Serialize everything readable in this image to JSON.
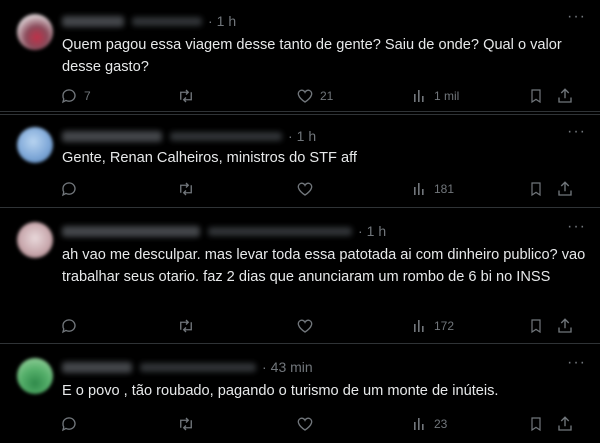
{
  "replies": [
    {
      "time": "1 h",
      "text": "Quem pagou essa viagem desse tanto de gente? Saiu de onde? Qual o valor desse gasto?",
      "comments": "7",
      "retweets": "",
      "likes": "21",
      "views": "1 mil"
    },
    {
      "time": "1 h",
      "text": "Gente, Renan Calheiros, ministros do STF aff",
      "comments": "",
      "retweets": "",
      "likes": "",
      "views": "181"
    },
    {
      "time": "1 h",
      "text": "ah vao me desculpar. mas levar toda essa patotada ai com dinheiro publico? vao trabalhar seus otario. faz 2 dias que anunciaram um rombo de 6 bi no INSS",
      "comments": "",
      "retweets": "",
      "likes": "",
      "views": "172"
    },
    {
      "time": "43 min",
      "text": "E o povo , tão roubado, pagando o turismo de um monte de inúteis.",
      "comments": "",
      "retweets": "",
      "likes": "",
      "views": "23"
    }
  ],
  "separator": "·",
  "more_glyph": "···",
  "icons": [
    "comment-icon",
    "retweet-icon",
    "heart-icon",
    "views-icon",
    "bookmark-icon",
    "share-icon",
    "more-icon"
  ],
  "colors": {
    "background": "#000000",
    "text": "#e7e9ea",
    "muted": "#71767b",
    "divider": "#2f3336"
  }
}
